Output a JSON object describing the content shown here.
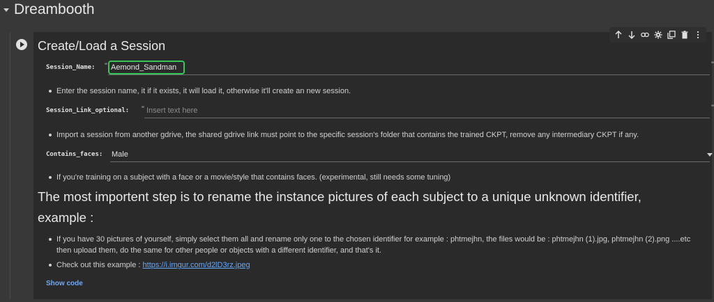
{
  "section": {
    "title": "Dreambooth"
  },
  "cell": {
    "title": "Create/Load a Session",
    "toolbar": [
      "arrow-up-icon",
      "arrow-down-icon",
      "link-icon",
      "gear-icon",
      "copy-icon",
      "trash-icon",
      "more-vert-icon"
    ],
    "fields": {
      "session_name": {
        "label": "Session_Name:",
        "value": "Aemond_Sandman",
        "quote_open": "\"",
        "quote_close": "\""
      },
      "session_link": {
        "label": "Session_Link_optional:",
        "value": "",
        "placeholder": "Insert text here",
        "quote_open": "\"",
        "quote_close": "\""
      },
      "contains_faces": {
        "label": "Contains_faces:",
        "value": "Male"
      }
    },
    "notes": {
      "session_name": "Enter the session name, it if it exists, it will load it, otherwise it'll create an new session.",
      "session_link": "Import a session from another gdrive, the shared gdrive link must point to the specific session's folder that contains the trained CKPT, remove any intermediary CKPT if any.",
      "contains_faces": "If you're training on a subject with a face or a movie/style that contains faces. (experimental, still needs some tuning)"
    },
    "heading": "The most importent step is to rename the instance pictures of each subject to a unique unknown identifier, example :",
    "instructions": {
      "rename": "If you have 30 pictures of yourself, simply select them all and rename only one to the chosen identifier for example : phtmejhn, the files would be : phtmejhn (1).jpg, phtmejhn (2).png ....etc then upload them, do the same for other people or objects with a different identifier, and that's it.",
      "example_prefix": "Check out this example : ",
      "example_link": "https://i.imgur.com/d2lD3rz.jpeg"
    },
    "show_code": "Show code"
  },
  "colors": {
    "accent_green": "#34c759",
    "link": "#64a8ff",
    "background": "#383838",
    "cell_background": "#2a2a2a"
  }
}
